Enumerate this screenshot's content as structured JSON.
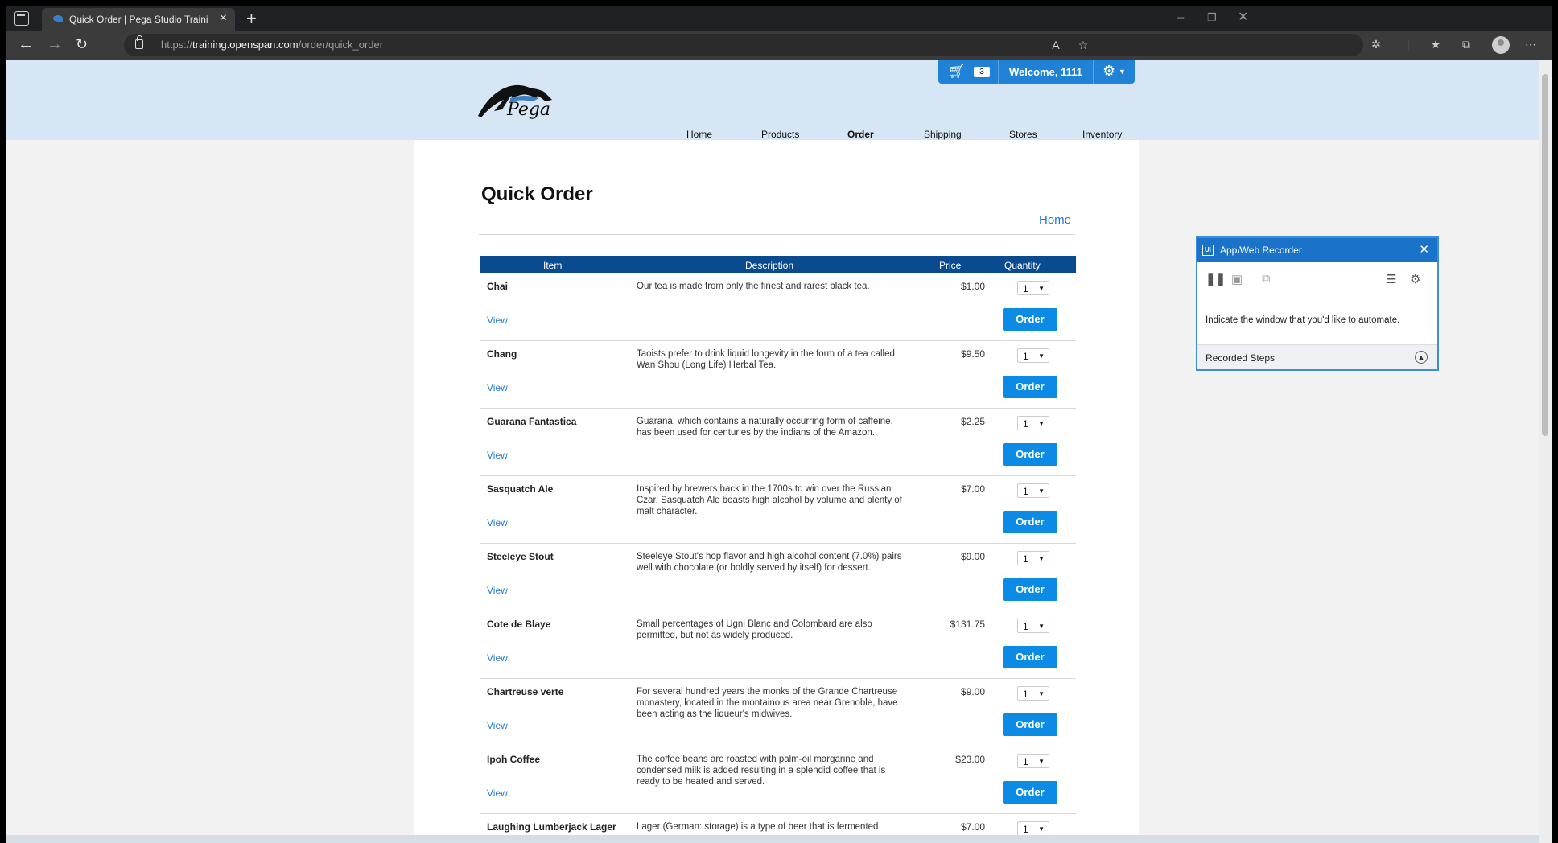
{
  "browser": {
    "tab_title": "Quick Order | Pega Studio Traini",
    "url_prefix": "https://",
    "url_domain": "training.openspan.com",
    "url_path": "/order/quick_order"
  },
  "site": {
    "logo_text": "Pega",
    "cart_count": "3",
    "welcome": "Welcome, 1111",
    "nav": [
      "Home",
      "Products",
      "Order",
      "Shipping",
      "Stores",
      "Inventory"
    ]
  },
  "page": {
    "title": "Quick Order",
    "home_link": "Home",
    "columns": [
      "Item",
      "Description",
      "Price",
      "Quantity"
    ],
    "view_label": "View",
    "order_label": "Order",
    "rows": [
      {
        "name": "Chai",
        "description": "Our tea is made from only the finest and rarest black tea.",
        "price": "$1.00",
        "qty": "1"
      },
      {
        "name": "Chang",
        "description": "Taoists prefer to drink liquid longevity in the form of a tea called Wan Shou (Long Life) Herbal Tea.",
        "price": "$9.50",
        "qty": "1"
      },
      {
        "name": "Guarana Fantastica",
        "description": "Guarana, which contains a naturally occurring form of caffeine, has been used for centuries by the indians of the Amazon.",
        "price": "$2.25",
        "qty": "1"
      },
      {
        "name": "Sasquatch Ale",
        "description": "Inspired by brewers back in the 1700s to win over the Russian Czar, Sasquatch Ale boasts high alcohol by volume and plenty of malt character.",
        "price": "$7.00",
        "qty": "1"
      },
      {
        "name": "Steeleye Stout",
        "description": "Steeleye Stout's hop flavor and high alcohol content (7.0%) pairs well with chocolate (or boldly served by itself) for dessert.",
        "price": "$9.00",
        "qty": "1"
      },
      {
        "name": "Cote de Blaye",
        "description": "Small percentages of Ugni Blanc and Colombard are also permitted, but not as widely produced.",
        "price": "$131.75",
        "qty": "1"
      },
      {
        "name": "Chartreuse verte",
        "description": "For several hundred years the monks of the Grande Chartreuse monastery, located in the montainous area near Grenoble, have been acting as the liqueur's midwives.",
        "price": "$9.00",
        "qty": "1"
      },
      {
        "name": "Ipoh Coffee",
        "description": "The coffee beans are roasted with palm-oil margarine and condensed milk is added resulting in a splendid coffee that is ready to be heated and served.",
        "price": "$23.00",
        "qty": "1"
      },
      {
        "name": "Laughing Lumberjack Lager",
        "description": "Lager (German: storage) is a type of beer that is fermented",
        "price": "$7.00",
        "qty": "1"
      }
    ]
  },
  "recorder": {
    "title": "App/Web Recorder",
    "message": "Indicate the window that you'd like to automate.",
    "steps_label": "Recorded Steps"
  },
  "colors": {
    "header_bg": "#d7e6f4",
    "accent_blue": "#1f82d6",
    "table_header": "#0a4a8f",
    "order_button": "#0b8be6"
  }
}
